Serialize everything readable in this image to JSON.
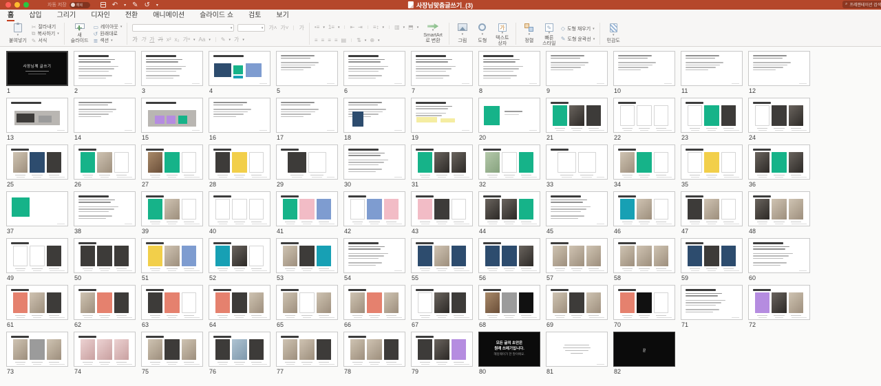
{
  "titlebar": {
    "autosave": "자동 저장",
    "autosave_state": "해제",
    "title": "사장님맞춤글쓰기_(3)",
    "search": "프레젠테이션 검색"
  },
  "tabs": [
    "홈",
    "삽입",
    "그리기",
    "디자인",
    "전환",
    "애니메이션",
    "슬라이드 쇼",
    "검토",
    "보기"
  ],
  "active_tab": "홈",
  "ribbon": {
    "paste": "붙여넣기",
    "cut": "잘라내기",
    "copy": "복사하기",
    "format": "서식",
    "new_slide": "새\n슬라이드",
    "layout": "레이아웃",
    "reset": "원래대로",
    "section": "섹션",
    "smartart": "SmartArt\n로 변환",
    "picture": "그림",
    "shapes": "도형",
    "textbox": "텍스트\n상자",
    "arrange": "정렬",
    "quick_styles": "빠른\n스타일",
    "shape_fill": "도형 채우기",
    "shape_outline": "도형 윤곽선",
    "sensitivity": "민감도",
    "font_name": "",
    "font_size": "",
    "glyphs": {
      "cut": "✂",
      "copy": "⧉",
      "format": "✎",
      "layout": "▭",
      "reset": "↺",
      "section": "≣",
      "inc": "가˄",
      "dec": "가˅",
      "clear": "가",
      "bold": "가",
      "italic": "가",
      "underline": "가",
      "strike": "가",
      "sup": "x²",
      "sub": "x₂",
      "spacing": "가ᵃ",
      "aa": "Aa",
      "pen": "✎",
      "color": "가",
      "bullets": "•≡",
      "numbering": "1≡",
      "outdent": "⇤",
      "indent": "⇥",
      "linespacing": "≡↕",
      "columns": "▥",
      "direction": "⬒",
      "alignl": "≡",
      "alignc": "≡",
      "alignr": "≡",
      "alignj": "≡",
      "distr": "▤",
      "updown": "⇅",
      "position": "⊕",
      "textbox_icon": "가",
      "style_icon": "✎",
      "fill": "◇",
      "outline": "✎",
      "undo": "↶",
      "redo": "✎",
      "repeat": "↺",
      "more": "▾",
      "search": "⌕"
    }
  },
  "palette": {
    "teal": "#16b389",
    "cyan": "#17a0b4",
    "navy": "#2d4c6e",
    "coral": "#e5816e",
    "purple": "#b58ce0",
    "pink": "#f2bcc6",
    "blue2": "#7e9cd0",
    "yellow": "#f2cf4a",
    "gray": "#9b9b9b",
    "lgray": "#cfcfcf",
    "black": "#111111",
    "dark": "#3d3b39",
    "hlyellow": "#f5eda2",
    "grayimg": "#b9b6b2",
    "green": "#18a868"
  },
  "gradients": {
    "photo": [
      "#cfc3b2",
      "#9d8f7d"
    ],
    "photo-dark": [
      "#6a645e",
      "#2c2926"
    ],
    "photo-brown": [
      "#a98a6a",
      "#6a4e38"
    ],
    "photo-green": [
      "#b5c9ab",
      "#86a27e"
    ],
    "photo-pink": [
      "#ecd2d2",
      "#c9a0a0"
    ],
    "photo-blue": [
      "#aec3d2",
      "#7e98ac"
    ]
  },
  "slides": [
    {
      "n": 1,
      "t": "dark",
      "title": "사장님께 글쓰기",
      "sel": true
    },
    {
      "n": 2,
      "t": "text",
      "h": true
    },
    {
      "n": 3,
      "t": "text",
      "h": true
    },
    {
      "n": 4,
      "t": "blocks",
      "h": true,
      "b": [
        [
          8,
          34,
          28,
          42,
          "navy"
        ],
        [
          40,
          40,
          16,
          28,
          "teal"
        ],
        [
          60,
          34,
          26,
          42,
          "blue2"
        ],
        [
          40,
          72,
          16,
          8,
          "cyan"
        ]
      ]
    },
    {
      "n": 5,
      "t": "text"
    },
    {
      "n": 6,
      "t": "text",
      "h": true
    },
    {
      "n": 7,
      "t": "text",
      "h": true
    },
    {
      "n": 8,
      "t": "text",
      "h": true
    },
    {
      "n": 9,
      "t": "text"
    },
    {
      "n": 10,
      "t": "text"
    },
    {
      "n": 11,
      "t": "text"
    },
    {
      "n": 12,
      "t": "text"
    },
    {
      "n": 13,
      "t": "blocks",
      "h": true,
      "b": [
        [
          12,
          36,
          76,
          44,
          "grayimg"
        ],
        [
          16,
          44,
          30,
          28,
          "dark"
        ],
        [
          52,
          52,
          22,
          20,
          "gray"
        ]
      ]
    },
    {
      "n": 14,
      "t": "text"
    },
    {
      "n": 15,
      "t": "blocks",
      "h": true,
      "b": [
        [
          10,
          34,
          80,
          50,
          "grayimg"
        ],
        [
          22,
          50,
          15,
          26,
          "purple"
        ],
        [
          41,
          50,
          15,
          26,
          "purple"
        ],
        [
          60,
          50,
          15,
          26,
          "teal"
        ]
      ]
    },
    {
      "n": 16,
      "t": "text"
    },
    {
      "n": 17,
      "t": "text"
    },
    {
      "n": 18,
      "t": "blocks",
      "lines": true,
      "b": [
        [
          14,
          38,
          18,
          46,
          "navy"
        ]
      ]
    },
    {
      "n": 19,
      "t": "blocks",
      "h": true,
      "lines": true,
      "b": [
        [
          8,
          56,
          34,
          16,
          "hlyellow"
        ],
        [
          48,
          60,
          24,
          12,
          "hlyellow"
        ]
      ]
    },
    {
      "n": 20,
      "t": "blocks",
      "b": [
        [
          8,
          22,
          26,
          58,
          "teal"
        ],
        [
          42,
          36,
          30,
          4,
          "gray"
        ],
        [
          42,
          46,
          24,
          3,
          "lgray"
        ]
      ]
    },
    {
      "n": 21,
      "t": "cards",
      "c": [
        "teal",
        "photo-dark",
        "dark"
      ]
    },
    {
      "n": 22,
      "t": "cards",
      "c": [
        "lightcard",
        "lightcard",
        "lightcard"
      ]
    },
    {
      "n": 23,
      "t": "cards",
      "c": [
        "lightcard",
        "teal",
        "dark"
      ]
    },
    {
      "n": 24,
      "t": "cards",
      "c": [
        "lightcard",
        "dark",
        "photo-dark"
      ]
    },
    {
      "n": 25,
      "t": "cards",
      "c": [
        "photo",
        "navy",
        "dark"
      ]
    },
    {
      "n": 26,
      "t": "cards",
      "c": [
        "teal",
        "photo",
        "lightcard"
      ]
    },
    {
      "n": 27,
      "t": "cards",
      "c": [
        "photo-brown",
        "teal",
        "lightcard"
      ]
    },
    {
      "n": 28,
      "t": "cards",
      "c": [
        "dark",
        "yellow",
        "lightcard"
      ]
    },
    {
      "n": 29,
      "t": "cards",
      "c": [
        "dark",
        "lightcard"
      ]
    },
    {
      "n": 30,
      "t": "text",
      "h": true
    },
    {
      "n": 31,
      "t": "cards",
      "c": [
        "teal",
        "photo-dark",
        "photo-dark"
      ]
    },
    {
      "n": 32,
      "t": "cards",
      "c": [
        "photo-green",
        "lightcard",
        "teal"
      ]
    },
    {
      "n": 33,
      "t": "cards",
      "c": [
        "lightcard",
        "lightcard"
      ]
    },
    {
      "n": 34,
      "t": "cards",
      "c": [
        "photo",
        "teal",
        "lightcard"
      ]
    },
    {
      "n": 35,
      "t": "cards",
      "c": [
        "lightcard",
        "yellow",
        "lightcard"
      ]
    },
    {
      "n": 36,
      "t": "cards",
      "c": [
        "photo-dark",
        "teal",
        "photo-dark"
      ]
    },
    {
      "n": 37,
      "t": "blocks",
      "b": [
        [
          8,
          16,
          30,
          58,
          "teal"
        ]
      ]
    },
    {
      "n": 38,
      "t": "text",
      "h": true
    },
    {
      "n": 39,
      "t": "cards",
      "c": [
        "teal",
        "photo",
        "lightcard"
      ]
    },
    {
      "n": 40,
      "t": "cards",
      "c": [
        "lightcard",
        "lightcard",
        "lightcard"
      ]
    },
    {
      "n": 41,
      "t": "cards",
      "c": [
        "teal",
        "pink",
        "blue2"
      ]
    },
    {
      "n": 42,
      "t": "cards",
      "c": [
        "lightcard",
        "blue2",
        "pink"
      ]
    },
    {
      "n": 43,
      "t": "cards",
      "c": [
        "pink",
        "dark",
        "lightcard"
      ]
    },
    {
      "n": 44,
      "t": "cards",
      "c": [
        "photo-dark",
        "photo-dark",
        "teal"
      ]
    },
    {
      "n": 45,
      "t": "text",
      "h": true
    },
    {
      "n": 46,
      "t": "cards",
      "c": [
        "cyan",
        "photo",
        "lightcard"
      ]
    },
    {
      "n": 47,
      "t": "cards",
      "c": [
        "dark",
        "photo",
        "lightcard"
      ]
    },
    {
      "n": 48,
      "t": "cards",
      "c": [
        "photo-dark",
        "photo",
        "photo"
      ]
    },
    {
      "n": 49,
      "t": "cards",
      "c": [
        "lightcard",
        "lightcard",
        "dark"
      ]
    },
    {
      "n": 50,
      "t": "cards",
      "c": [
        "dark",
        "dark",
        "dark"
      ]
    },
    {
      "n": 51,
      "t": "cards",
      "c": [
        "yellow",
        "photo",
        "blue2"
      ]
    },
    {
      "n": 52,
      "t": "cards",
      "c": [
        "cyan",
        "photo-dark",
        "lightcard"
      ]
    },
    {
      "n": 53,
      "t": "cards",
      "c": [
        "photo",
        "dark",
        "cyan"
      ]
    },
    {
      "n": 54,
      "t": "text",
      "h": true
    },
    {
      "n": 55,
      "t": "cards",
      "c": [
        "navy",
        "photo",
        "navy"
      ]
    },
    {
      "n": 56,
      "t": "cards",
      "c": [
        "navy",
        "navy",
        "photo-dark"
      ]
    },
    {
      "n": 57,
      "t": "cards",
      "c": [
        "photo",
        "photo",
        "photo"
      ]
    },
    {
      "n": 58,
      "t": "cards",
      "c": [
        "photo",
        "photo",
        "photo"
      ]
    },
    {
      "n": 59,
      "t": "cards",
      "c": [
        "navy",
        "dark",
        "navy"
      ]
    },
    {
      "n": 60,
      "t": "text",
      "h": true
    },
    {
      "n": 61,
      "t": "cards",
      "c": [
        "coral",
        "photo",
        "dark"
      ]
    },
    {
      "n": 62,
      "t": "cards",
      "c": [
        "photo",
        "coral",
        "dark"
      ]
    },
    {
      "n": 63,
      "t": "cards",
      "c": [
        "dark",
        "coral",
        "lightcard"
      ]
    },
    {
      "n": 64,
      "t": "cards",
      "c": [
        "coral",
        "dark",
        "photo"
      ]
    },
    {
      "n": 65,
      "t": "cards",
      "c": [
        "photo",
        "lightcard",
        "photo"
      ]
    },
    {
      "n": 66,
      "t": "cards",
      "c": [
        "photo",
        "coral",
        "photo"
      ]
    },
    {
      "n": 67,
      "t": "cards",
      "c": [
        "lightcard",
        "photo-dark",
        "dark"
      ]
    },
    {
      "n": 68,
      "t": "cards",
      "c": [
        "photo-brown",
        "gray",
        "black"
      ]
    },
    {
      "n": 69,
      "t": "cards",
      "c": [
        "photo",
        "dark",
        "photo"
      ]
    },
    {
      "n": 70,
      "t": "cards",
      "c": [
        "coral",
        "black",
        "lightcard"
      ]
    },
    {
      "n": 71,
      "t": "text",
      "h": true
    },
    {
      "n": 72,
      "t": "cards",
      "c": [
        "purple",
        "photo-dark",
        "photo"
      ]
    },
    {
      "n": 73,
      "t": "cards",
      "c": [
        "photo",
        "gray",
        "photo"
      ]
    },
    {
      "n": 74,
      "t": "cards",
      "c": [
        "photo-pink",
        "photo-pink",
        "photo-pink"
      ]
    },
    {
      "n": 75,
      "t": "cards",
      "c": [
        "photo",
        "dark",
        "photo"
      ]
    },
    {
      "n": 76,
      "t": "cards",
      "c": [
        "dark",
        "photo-blue",
        "dark"
      ]
    },
    {
      "n": 77,
      "t": "cards",
      "c": [
        "photo",
        "photo",
        "dark"
      ]
    },
    {
      "n": 78,
      "t": "cards",
      "c": [
        "photo",
        "photo",
        "dark"
      ]
    },
    {
      "n": 79,
      "t": "cards",
      "c": [
        "dark",
        "photo-dark",
        "purple"
      ]
    },
    {
      "n": 80,
      "t": "quote",
      "l1": "모든 글의 초안은",
      "l2": "원래 쓰레기입니다.",
      "l3": "헤밍웨이가 한 말이에요."
    },
    {
      "n": 81,
      "t": "center"
    },
    {
      "n": 82,
      "t": "end",
      "title": "끝"
    }
  ]
}
